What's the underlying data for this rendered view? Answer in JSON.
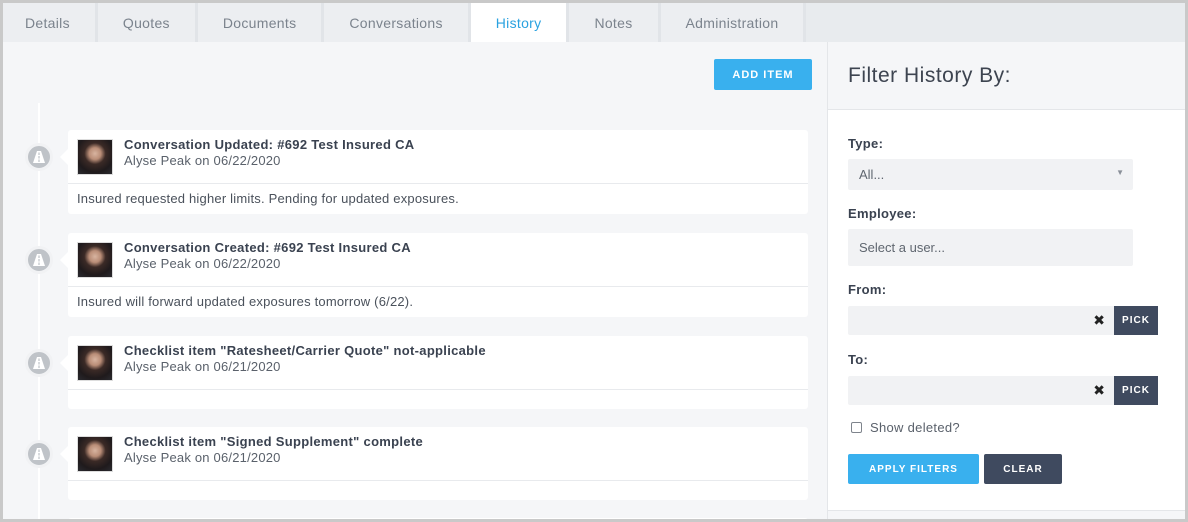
{
  "tabs": [
    {
      "label": "Details"
    },
    {
      "label": "Quotes"
    },
    {
      "label": "Documents"
    },
    {
      "label": "Conversations"
    },
    {
      "label": "History",
      "active": true
    },
    {
      "label": "Notes"
    },
    {
      "label": "Administration"
    }
  ],
  "main": {
    "add_item_label": "ADD ITEM",
    "entries": [
      {
        "title": "Conversation Updated: #692 Test Insured CA",
        "author": "Alyse Peak",
        "on": "on",
        "date": "06/22/2020",
        "body": "Insured requested higher limits. Pending for updated exposures."
      },
      {
        "title": "Conversation Created: #692 Test Insured CA",
        "author": "Alyse Peak",
        "on": "on",
        "date": "06/22/2020",
        "body": "Insured will forward updated exposures tomorrow (6/22)."
      },
      {
        "title": "Checklist item \"Ratesheet/Carrier Quote\" not-applicable",
        "author": "Alyse Peak",
        "on": "on",
        "date": "06/21/2020",
        "body": ""
      },
      {
        "title": "Checklist item \"Signed Supplement\" complete",
        "author": "Alyse Peak",
        "on": "on",
        "date": "06/21/2020",
        "body": ""
      }
    ]
  },
  "filter": {
    "heading": "Filter History By:",
    "type_label": "Type:",
    "type_value": "All...",
    "employee_label": "Employee:",
    "employee_placeholder": "Select a user...",
    "from_label": "From:",
    "to_label": "To:",
    "pick_label": "PICK",
    "clear_symbol": "✖",
    "show_deleted_label": "Show deleted?",
    "apply_label": "APPLY FILTERS",
    "clear_label": "CLEAR"
  },
  "colors": {
    "accent": "#39b0ee",
    "active_tab_text": "#2aa2e0",
    "dark_button": "#3f4a5f"
  },
  "icons": {
    "timeline_marker": "road-icon",
    "select_caret": "caret-down-icon",
    "clear": "close-icon"
  }
}
